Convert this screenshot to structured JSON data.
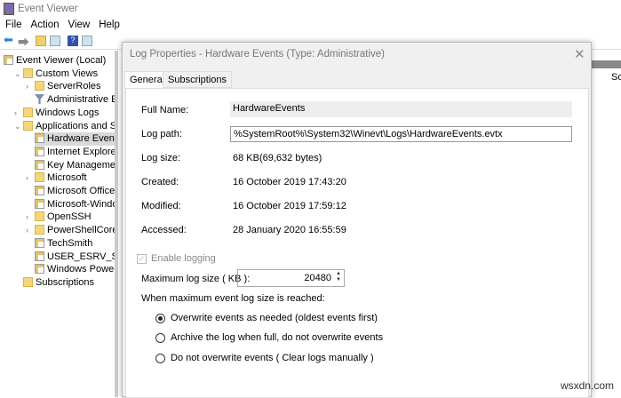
{
  "window": {
    "title": "Event Viewer"
  },
  "menu": [
    "File",
    "Action",
    "View",
    "Help"
  ],
  "toolbar": {
    "icons": [
      "back-arrow-icon",
      "forward-arrow-icon",
      "folder-up-icon",
      "show-hide-pane-icon",
      "help-icon",
      "action-pane-icon"
    ]
  },
  "tree": {
    "items": [
      {
        "label": "Event Viewer (Local)",
        "level": 0,
        "icon": "event-viewer-icon"
      },
      {
        "label": "Custom Views",
        "level": 1,
        "expanded": true,
        "icon": "folder-icon"
      },
      {
        "label": "ServerRoles",
        "level": 2,
        "collapsed": true,
        "icon": "folder-icon"
      },
      {
        "label": "Administrative Even",
        "level": 2,
        "icon": "filter-icon"
      },
      {
        "label": "Windows Logs",
        "level": 1,
        "collapsed": true,
        "icon": "folder-icon"
      },
      {
        "label": "Applications and Servic",
        "level": 1,
        "expanded": true,
        "icon": "folder-icon"
      },
      {
        "label": "Hardware Events",
        "level": 2,
        "selected": true,
        "icon": "log-icon"
      },
      {
        "label": "Internet Explorer",
        "level": 2,
        "icon": "log-icon"
      },
      {
        "label": "Key Management Se",
        "level": 2,
        "icon": "log-icon"
      },
      {
        "label": "Microsoft",
        "level": 2,
        "collapsed": true,
        "icon": "folder-icon"
      },
      {
        "label": "Microsoft Office Ale",
        "level": 2,
        "icon": "log-icon"
      },
      {
        "label": "Microsoft-Windows",
        "level": 2,
        "icon": "log-icon"
      },
      {
        "label": "OpenSSH",
        "level": 2,
        "collapsed": true,
        "icon": "folder-icon"
      },
      {
        "label": "PowerShellCore",
        "level": 2,
        "collapsed": true,
        "icon": "folder-icon"
      },
      {
        "label": "TechSmith",
        "level": 2,
        "icon": "log-icon"
      },
      {
        "label": "USER_ESRV_SVC_QU",
        "level": 2,
        "icon": "log-icon"
      },
      {
        "label": "Windows PowerShel",
        "level": 2,
        "icon": "log-icon"
      },
      {
        "label": "Subscriptions",
        "level": 1,
        "icon": "subscriptions-icon"
      }
    ]
  },
  "background": {
    "column_header": "So"
  },
  "dialog": {
    "title": "Log Properties - Hardware Events (Type: Administrative)",
    "tabs": [
      {
        "label": "General",
        "active": true
      },
      {
        "label": "Subscriptions"
      }
    ],
    "full_name_label": "Full Name:",
    "full_name": "HardwareEvents",
    "log_path_label": "Log path:",
    "log_path": "%SystemRoot%\\System32\\Winevt\\Logs\\HardwareEvents.evtx",
    "log_size_label": "Log size:",
    "log_size": "68 KB(69,632 bytes)",
    "created_label": "Created:",
    "created": "16 October 2019 17:43:20",
    "modified_label": "Modified:",
    "modified": "16 October 2019 17:59:12",
    "accessed_label": "Accessed:",
    "accessed": "28 January 2020 16:55:59",
    "enable_logging_label": "Enable logging",
    "enable_logging": true,
    "max_size_label": "Maximum log size ( KB ):",
    "max_size": "20480",
    "when_reached_label": "When maximum event log size is reached:",
    "options": [
      {
        "label": "Overwrite events as needed (oldest events first)",
        "selected": true
      },
      {
        "label": "Archive the log when full, do not overwrite events",
        "selected": false
      },
      {
        "label": "Do not overwrite events ( Clear logs manually )",
        "selected": false
      }
    ]
  },
  "watermark": "wsxdn.com"
}
